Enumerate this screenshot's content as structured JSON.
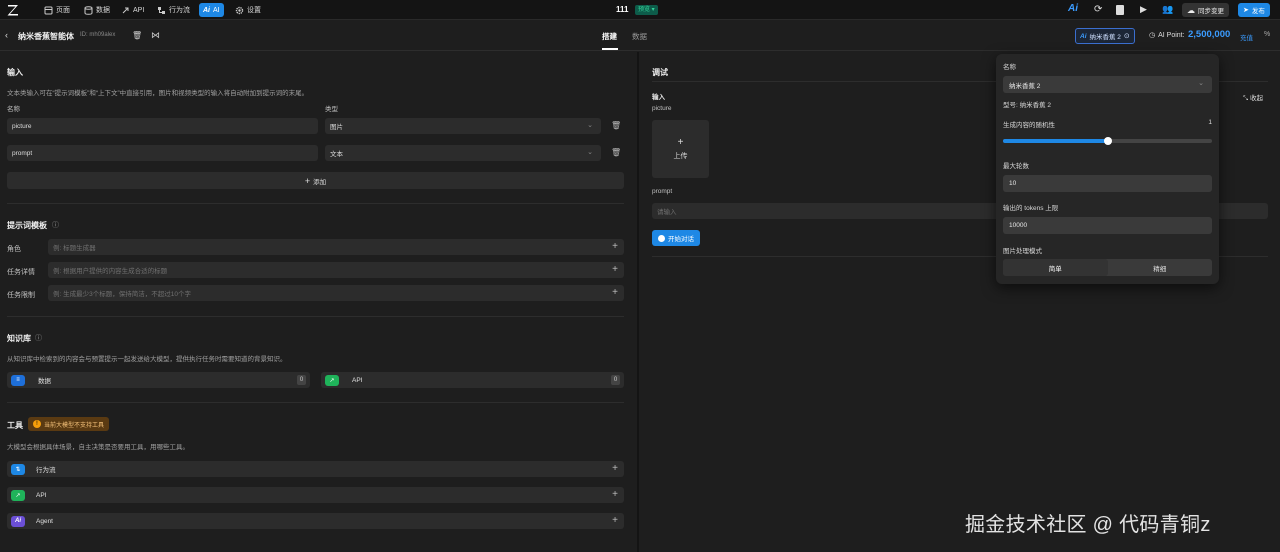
{
  "topnav": {
    "items": [
      {
        "label": "页面",
        "icon": "page-icon"
      },
      {
        "label": "数据",
        "icon": "database-icon"
      },
      {
        "label": "API",
        "icon": "api-icon"
      },
      {
        "label": "行为流",
        "icon": "flow-icon"
      },
      {
        "label": "AI",
        "icon": "ai-icon",
        "active": true
      },
      {
        "label": "设置",
        "icon": "gear-icon"
      }
    ],
    "project_name": "111",
    "env_badge": "预览",
    "sync_label": "同步变更",
    "publish_label": "发布"
  },
  "subbar": {
    "agent_title": "纳米香蕉智能体",
    "agent_id": "ID: mh09alex",
    "tabs": [
      {
        "label": "搭建",
        "active": true
      },
      {
        "label": "数据",
        "active": false
      }
    ],
    "model_label": "纳米香蕉 2",
    "ai_point_label": "AI Point:",
    "ai_point_value": "2,500,000",
    "recharge_label": "充值"
  },
  "input_section": {
    "title": "输入",
    "desc": "文本类输入可在“提示词模板”和“上下文”中直接引用，图片和视频类型的输入将自动附加到提示词的末尾。",
    "col_name": "名称",
    "col_type": "类型",
    "rows": [
      {
        "name": "picture",
        "type": "图片"
      },
      {
        "name": "prompt",
        "type": "文本"
      }
    ],
    "add_label": "添加"
  },
  "prompt_section": {
    "title": "提示词模板",
    "rows": [
      {
        "label": "角色",
        "placeholder": "例: 标题生成器"
      },
      {
        "label": "任务详情",
        "placeholder": "例: 根据用户提供的内容生成合适的标题"
      },
      {
        "label": "任务限制",
        "placeholder": "例: 生成最少3个标题，保持简洁，不超过10个字"
      }
    ]
  },
  "kb_section": {
    "title": "知识库",
    "desc": "从知识库中检索到的内容会与预置提示一起发送给大模型，提供执行任务时需要知道的背景知识。",
    "items": [
      {
        "label": "数据",
        "count": "0",
        "color": "#1e6fd9"
      },
      {
        "label": "API",
        "count": "0",
        "color": "#1fb35a"
      }
    ]
  },
  "tools_section": {
    "title": "工具",
    "warning": "当前大模型不支持工具",
    "desc": "大模型会根据具体场景，自主决策是否要用工具，用哪些工具。",
    "items": [
      {
        "label": "行为流",
        "color": "#1e88e5"
      },
      {
        "label": "API",
        "color": "#1fb35a"
      },
      {
        "label": "Agent",
        "color": "#6b4fd6"
      }
    ]
  },
  "debug": {
    "title": "调试",
    "input_label": "输入",
    "collapse_label": "收起",
    "picture_label": "picture",
    "upload_label": "上传",
    "prompt_label": "prompt",
    "prompt_placeholder": "请输入",
    "start_label": "开始对话"
  },
  "model_popover": {
    "name_label": "名称",
    "name_value": "纳米香蕉 2",
    "model_type": "型号: 纳米香蕉 2",
    "randomness_label": "生成内容的随机性",
    "randomness_value": "1",
    "randomness_fraction": 0.5,
    "max_turns_label": "最大轮数",
    "max_turns_value": "10",
    "max_tokens_label": "输出的 tokens 上限",
    "max_tokens_value": "10000",
    "image_mode_label": "图片处理模式",
    "image_modes": [
      "简单",
      "精细"
    ]
  },
  "watermark": "掘金技术社区 @ 代码青铜z",
  "colors": {
    "accent": "#1e88e5",
    "bg": "#1e1e1e",
    "topbar": "#141414"
  }
}
